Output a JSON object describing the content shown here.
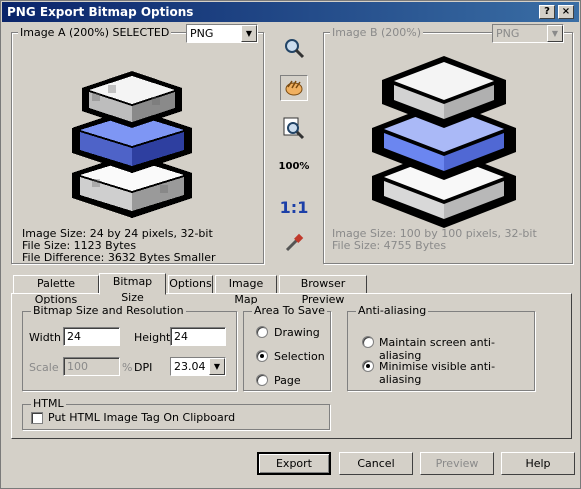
{
  "window": {
    "title": "PNG Export Bitmap Options"
  },
  "image_a": {
    "label": "Image A (200%) SELECTED",
    "format": "PNG",
    "info": [
      "Image Size: 24 by 24 pixels, 32-bit",
      "File Size: 1123 Bytes",
      "File Difference: 3632 Bytes Smaller"
    ]
  },
  "image_b": {
    "label": "Image B (200%)",
    "format": "PNG",
    "info": [
      "Image Size: 100 by 100 pixels, 32-bit",
      "File Size: 4755 Bytes"
    ]
  },
  "toolbar": {
    "zoom_pct": "100%",
    "one_to_one": "1:1"
  },
  "tabs": [
    "Palette Options",
    "Bitmap Size",
    "Options",
    "Image Map",
    "Browser Preview"
  ],
  "bitmap": {
    "group": "Bitmap Size and Resolution",
    "width_label": "Width",
    "width_value": "24",
    "height_label": "Height",
    "height_value": "24",
    "scale_label": "Scale",
    "scale_value": "100",
    "pct": "%",
    "dpi_label": "DPI",
    "dpi_value": "23.04"
  },
  "area": {
    "group": "Area To Save",
    "options": [
      "Drawing",
      "Selection",
      "Page"
    ],
    "selected": "Selection"
  },
  "aa": {
    "group": "Anti-aliasing",
    "options": [
      "Maintain screen anti-aliasing",
      "Minimise visible anti-aliasing"
    ],
    "selected": "Minimise visible anti-aliasing"
  },
  "html": {
    "group": "HTML",
    "checkbox_label": "Put HTML Image Tag On Clipboard"
  },
  "buttons": {
    "export": "Export",
    "cancel": "Cancel",
    "preview": "Preview",
    "help": "Help"
  },
  "colors": {
    "title_start": "#0a246a",
    "title_end": "#3a6ea5",
    "layer_blue": "#6b86f0",
    "face": "#d4d0c8"
  }
}
